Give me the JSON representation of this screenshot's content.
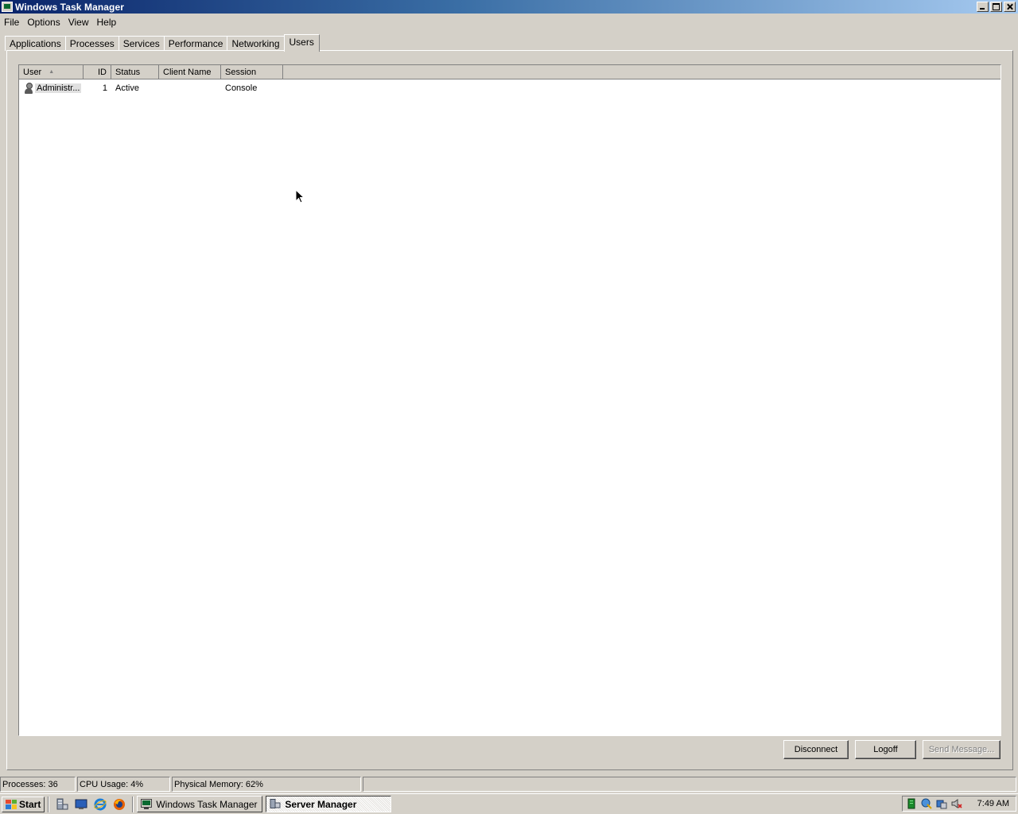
{
  "window": {
    "title": "Windows Task Manager"
  },
  "menu": [
    "File",
    "Options",
    "View",
    "Help"
  ],
  "tabs": [
    {
      "label": "Applications",
      "active": false
    },
    {
      "label": "Processes",
      "active": false
    },
    {
      "label": "Services",
      "active": false
    },
    {
      "label": "Performance",
      "active": false
    },
    {
      "label": "Networking",
      "active": false
    },
    {
      "label": "Users",
      "active": true
    }
  ],
  "users_table": {
    "columns": {
      "user": "User",
      "id": "ID",
      "status": "Status",
      "client_name": "Client Name",
      "session": "Session"
    },
    "sorted_by": "User",
    "sort_direction": "ascending",
    "rows": [
      {
        "user": "Administr...",
        "id": "1",
        "status": "Active",
        "client_name": "",
        "session": "Console",
        "icon": "user-icon"
      }
    ]
  },
  "buttons": {
    "disconnect": "Disconnect",
    "logoff": "Logoff",
    "send_message": "Send Message..."
  },
  "status_bar": {
    "processes": "Processes: 36",
    "cpu": "CPU Usage: 4%",
    "memory": "Physical Memory: 62%"
  },
  "taskbar": {
    "start": "Start",
    "quick_launch": [
      "server-manager-icon",
      "show-desktop-icon",
      "internet-explorer-icon",
      "firefox-icon"
    ],
    "tasks": [
      {
        "label": "Windows Task Manager",
        "active": false
      },
      {
        "label": "Server Manager",
        "active": true
      }
    ],
    "tray_icons": [
      "network-icon",
      "security-icon",
      "update-icon",
      "volume-muted-icon"
    ],
    "clock": "7:49 AM"
  },
  "colors": {
    "title_start": "#0a246a",
    "title_end": "#a6caf0",
    "face": "#d4d0c8"
  }
}
